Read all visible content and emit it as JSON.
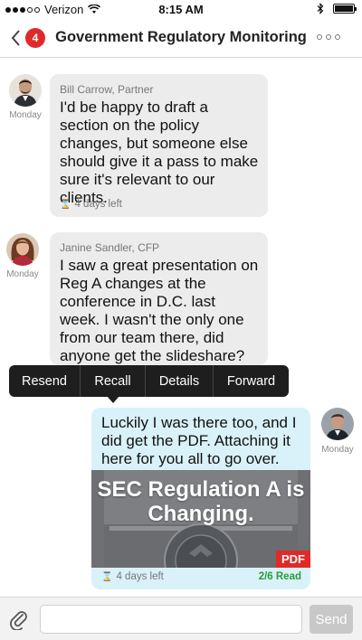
{
  "status_bar": {
    "carrier": "Verizon",
    "time": "8:15 AM",
    "icons": [
      "signal-dots",
      "wifi-icon",
      "bluetooth-icon",
      "battery-icon"
    ]
  },
  "nav": {
    "back_icon": "chevron-left-icon",
    "unread_count": "4",
    "title": "Government Regulatory Monitoring",
    "more_icon": "more-dots-icon"
  },
  "messages": [
    {
      "sender": "Bill Carrow, Partner",
      "avatar_caption": "Monday",
      "text": "I'd be happy to draft a section on the policy changes, but someone else should give it a pass to make sure it's relevant to our clients.",
      "expiry": "4 days left",
      "direction": "incoming"
    },
    {
      "sender": "Janine Sandler, CFP",
      "avatar_caption": "Monday",
      "text": "I saw a great presentation on Reg A changes at the conference in D.C. last week. I wasn't the only one from our team there, did anyone get the slideshare?",
      "direction": "incoming"
    },
    {
      "avatar_caption": "Monday",
      "text": "Luckily I was there too, and I did get the PDF. Attaching it here for you all to go over.",
      "attachment": {
        "title": "SEC Regulation A is Changing.",
        "badge": "PDF"
      },
      "expiry": "4 days left",
      "read_status": "2/6 Read",
      "direction": "outgoing"
    }
  ],
  "context_menu": {
    "items": [
      "Resend",
      "Recall",
      "Details",
      "Forward"
    ]
  },
  "compose": {
    "placeholder": "",
    "send_label": "Send"
  },
  "colors": {
    "badge": "#e02a2a",
    "incoming_bubble": "#ececec",
    "outgoing_bubble": "#d9f1f9",
    "read_status": "#2a9d3a",
    "context_menu": "#1e1e1e"
  }
}
